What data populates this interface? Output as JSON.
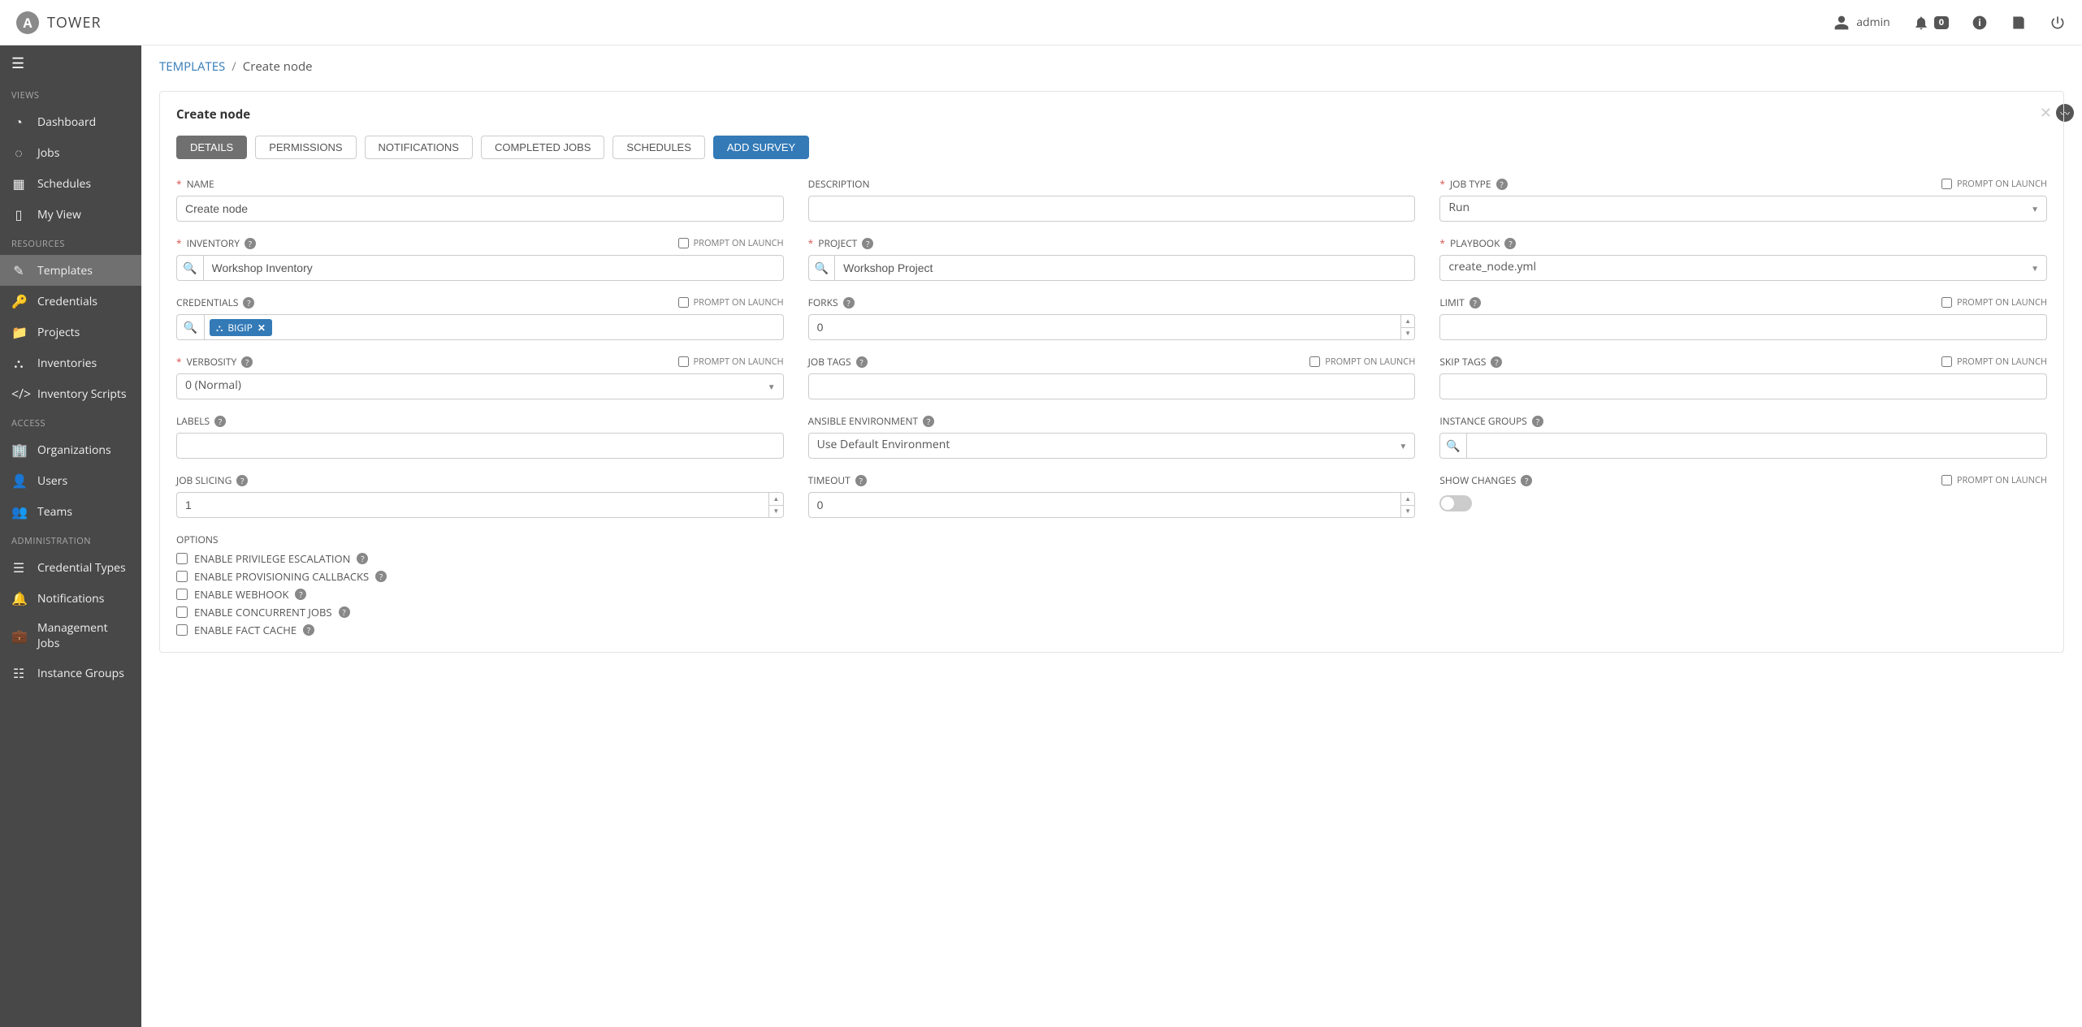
{
  "brand": {
    "logo_letter": "A",
    "name": "TOWER"
  },
  "topbar": {
    "user": "admin",
    "notif_count": "0"
  },
  "sidebar": {
    "sections": {
      "views": "VIEWS",
      "resources": "RESOURCES",
      "access": "ACCESS",
      "administration": "ADMINISTRATION"
    },
    "items": {
      "dashboard": "Dashboard",
      "jobs": "Jobs",
      "schedules": "Schedules",
      "myview": "My View",
      "templates": "Templates",
      "credentials": "Credentials",
      "projects": "Projects",
      "inventories": "Inventories",
      "inventory_scripts": "Inventory Scripts",
      "organizations": "Organizations",
      "users": "Users",
      "teams": "Teams",
      "credential_types": "Credential Types",
      "notifications": "Notifications",
      "management_jobs": "Management Jobs",
      "instance_groups": "Instance Groups"
    }
  },
  "breadcrumb": {
    "root": "TEMPLATES",
    "current": "Create node"
  },
  "panel": {
    "title": "Create node",
    "tabs": {
      "details": "DETAILS",
      "permissions": "PERMISSIONS",
      "notifications": "NOTIFICATIONS",
      "completed_jobs": "COMPLETED JOBS",
      "schedules": "SCHEDULES",
      "add_survey": "ADD SURVEY"
    }
  },
  "labels": {
    "name": "NAME",
    "description": "DESCRIPTION",
    "job_type": "JOB TYPE",
    "inventory": "INVENTORY",
    "project": "PROJECT",
    "playbook": "PLAYBOOK",
    "credentials": "CREDENTIALS",
    "forks": "FORKS",
    "limit": "LIMIT",
    "verbosity": "VERBOSITY",
    "job_tags": "JOB TAGS",
    "skip_tags": "SKIP TAGS",
    "labels_field": "LABELS",
    "ansible_env": "ANSIBLE ENVIRONMENT",
    "instance_groups": "INSTANCE GROUPS",
    "job_slicing": "JOB SLICING",
    "timeout": "TIMEOUT",
    "show_changes": "SHOW CHANGES",
    "options": "OPTIONS",
    "prompt_on_launch": "PROMPT ON LAUNCH"
  },
  "values": {
    "name": "Create node",
    "description": "",
    "job_type": "Run",
    "inventory": "Workshop Inventory",
    "project": "Workshop Project",
    "playbook": "create_node.yml",
    "credential_chip": "BIGIP",
    "forks": "0",
    "limit": "",
    "verbosity": "0 (Normal)",
    "job_tags": "",
    "skip_tags": "",
    "labels": "",
    "ansible_env": "Use Default Environment",
    "instance_groups": "",
    "job_slicing": "1",
    "timeout": "0"
  },
  "options": {
    "priv_escalation": "ENABLE PRIVILEGE ESCALATION",
    "prov_callbacks": "ENABLE PROVISIONING CALLBACKS",
    "webhook": "ENABLE WEBHOOK",
    "concurrent_jobs": "ENABLE CONCURRENT JOBS",
    "fact_cache": "ENABLE FACT CACHE"
  }
}
